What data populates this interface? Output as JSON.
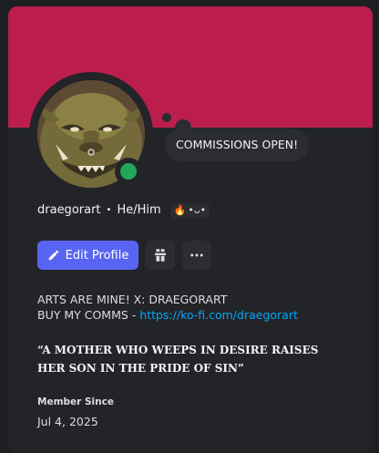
{
  "profile": {
    "note": "COMMISSIONS OPEN!",
    "username": "draegorart",
    "separator": "•",
    "pronouns": "He/Him",
    "badge_emoji": "🔥",
    "badge_face": "•ᴗ•",
    "status": "online",
    "status_color": "#23a55a",
    "banner_color": "#bb1e4d"
  },
  "actions": {
    "edit_profile_label": "Edit Profile",
    "accent_color": "#5865f2"
  },
  "bio": {
    "line1": "ARTS ARE MINE! X: DRAEGORART",
    "line2_prefix": "BUY MY COMMS - ",
    "link": "https://ko-fi.com/draegorart",
    "quote": "“A MOTHER WHO WEEPS IN DESIRE RAISES HER SON IN THE PRIDE OF SIN”"
  },
  "member": {
    "label": "Member Since",
    "date": "Jul 4, 2025"
  }
}
